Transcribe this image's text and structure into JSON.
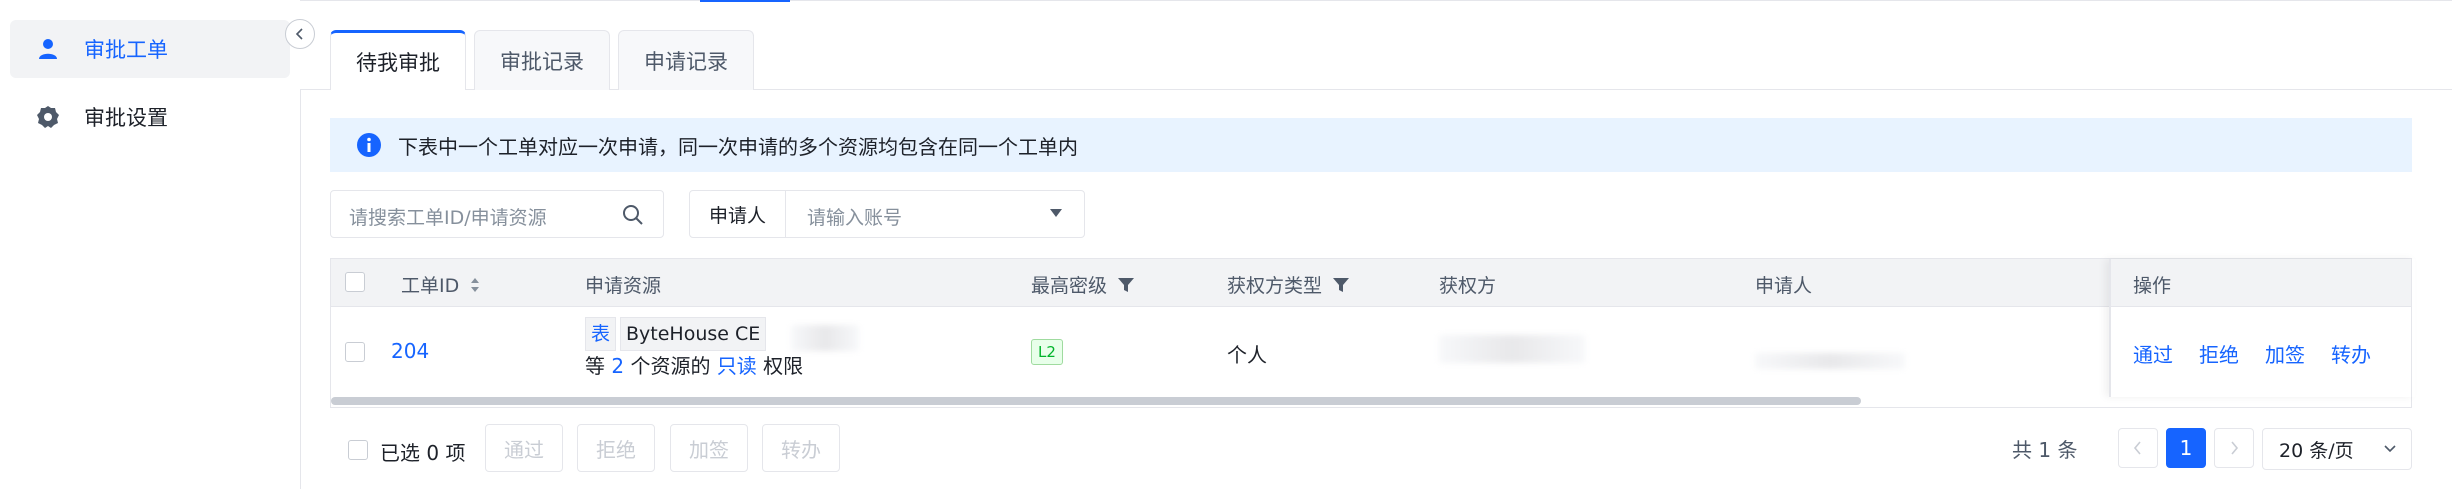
{
  "sidebar": {
    "items": [
      {
        "label": "审批工单",
        "icon": "user-icon",
        "active": true
      },
      {
        "label": "审批设置",
        "icon": "gear-icon",
        "active": false
      }
    ]
  },
  "tabs": [
    {
      "label": "待我审批",
      "active": true
    },
    {
      "label": "审批记录",
      "active": false
    },
    {
      "label": "申请记录",
      "active": false
    }
  ],
  "info_banner": {
    "text": "下表中一个工单对应一次申请，同一次申请的多个资源均包含在同一个工单内",
    "icon": "info-icon"
  },
  "search": {
    "placeholder": "请搜索工单ID/申请资源"
  },
  "applicant_filter": {
    "label": "申请人",
    "placeholder": "请输入账号"
  },
  "table": {
    "columns": [
      "工单ID",
      "申请资源",
      "最高密级",
      "获权方类型",
      "获权方",
      "申请人",
      "操作"
    ],
    "rows": [
      {
        "id": "204",
        "resource_tag_type": "表",
        "resource_tag_name": "ByteHouse CE",
        "resource_prefix": "等",
        "resource_count": "2",
        "resource_middle": "个资源的",
        "resource_perm": "只读",
        "resource_suffix": "权限",
        "level": "L2",
        "grantee_type": "个人",
        "actions": [
          "通过",
          "拒绝",
          "加签",
          "转办"
        ]
      }
    ]
  },
  "footer": {
    "selected_prefix": "已选",
    "selected_count": "0",
    "selected_suffix": "项",
    "bulk_actions": [
      "通过",
      "拒绝",
      "加签",
      "转办"
    ],
    "total_text": "共 1 条",
    "current_page": "1",
    "page_size": "20 条/页"
  },
  "colors": {
    "primary": "#1664ff",
    "info_bg": "#e8f3ff",
    "level_green": "#00b42a"
  }
}
